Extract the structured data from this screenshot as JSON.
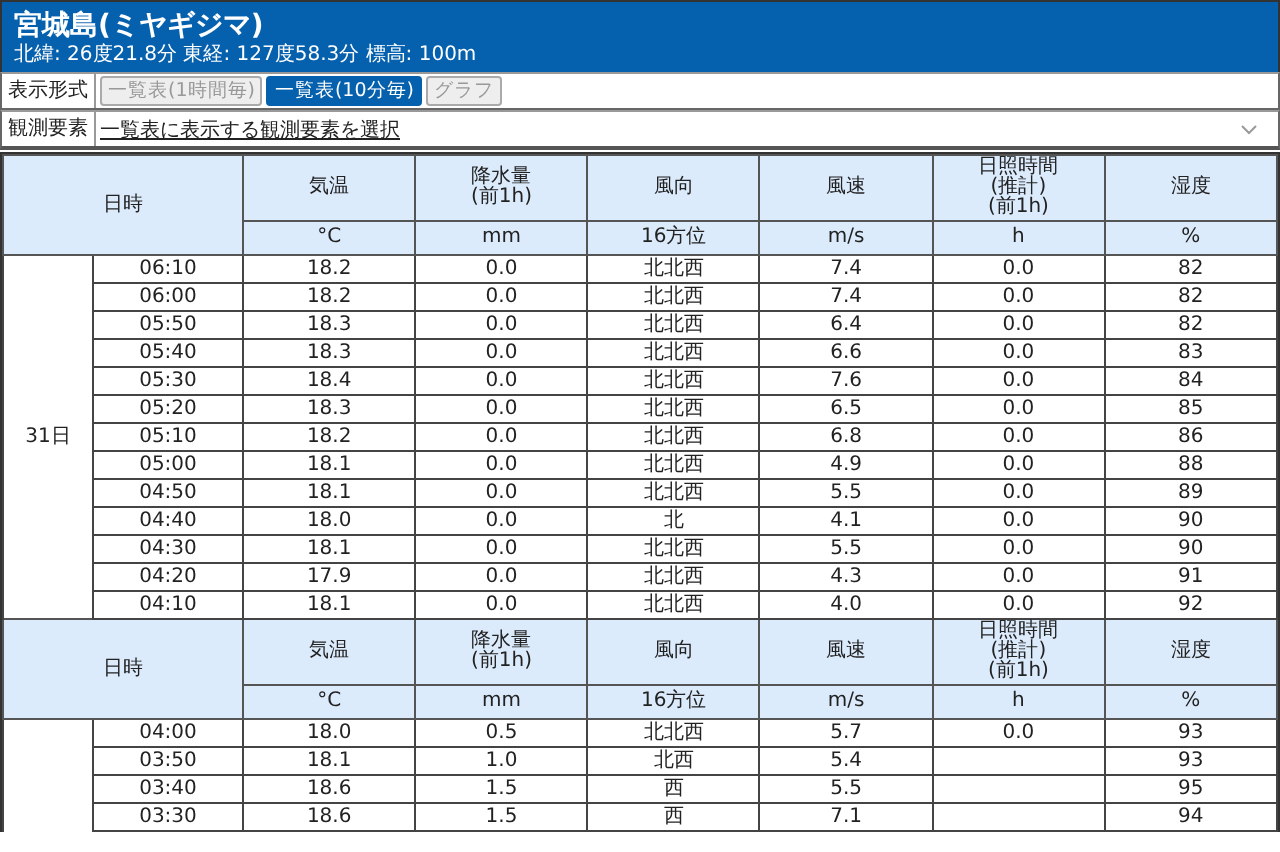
{
  "station": {
    "title": "宮城島(ミヤギジマ)",
    "coords": "北緯: 26度21.8分 東経: 127度58.3分 標高: 100m"
  },
  "display_format": {
    "label": "表示形式",
    "buttons": [
      {
        "label": "一覧表(1時間毎)",
        "selected": false
      },
      {
        "label": "一覧表(10分毎)",
        "selected": true
      },
      {
        "label": "グラフ",
        "selected": false
      }
    ]
  },
  "elements": {
    "label": "観測要素",
    "dropdown": "一覧表に表示する観測要素を選択"
  },
  "blocks": [
    {
      "columns": [
        {
          "label": "日時"
        },
        {
          "label": "気温",
          "unit": "°C"
        },
        {
          "label": "降水量\n(前1h)",
          "unit": "mm"
        },
        {
          "label": "風向",
          "unit": "16方位"
        },
        {
          "label": "風速",
          "unit": "m/s"
        },
        {
          "label": "日照時間\n(推計)\n(前1h)",
          "unit": "h"
        },
        {
          "label": "湿度",
          "unit": "%"
        }
      ],
      "date": "31日",
      "rows": [
        {
          "time": "06:10",
          "temp": "18.2",
          "precip": "0.0",
          "wind_dir": "北北西",
          "wind_speed": "7.4",
          "sunshine": "0.0",
          "humidity": "82"
        },
        {
          "time": "06:00",
          "temp": "18.2",
          "precip": "0.0",
          "wind_dir": "北北西",
          "wind_speed": "7.4",
          "sunshine": "0.0",
          "humidity": "82"
        },
        {
          "time": "05:50",
          "temp": "18.3",
          "precip": "0.0",
          "wind_dir": "北北西",
          "wind_speed": "6.4",
          "sunshine": "0.0",
          "humidity": "82"
        },
        {
          "time": "05:40",
          "temp": "18.3",
          "precip": "0.0",
          "wind_dir": "北北西",
          "wind_speed": "6.6",
          "sunshine": "0.0",
          "humidity": "83"
        },
        {
          "time": "05:30",
          "temp": "18.4",
          "precip": "0.0",
          "wind_dir": "北北西",
          "wind_speed": "7.6",
          "sunshine": "0.0",
          "humidity": "84"
        },
        {
          "time": "05:20",
          "temp": "18.3",
          "precip": "0.0",
          "wind_dir": "北北西",
          "wind_speed": "6.5",
          "sunshine": "0.0",
          "humidity": "85"
        },
        {
          "time": "05:10",
          "temp": "18.2",
          "precip": "0.0",
          "wind_dir": "北北西",
          "wind_speed": "6.8",
          "sunshine": "0.0",
          "humidity": "86"
        },
        {
          "time": "05:00",
          "temp": "18.1",
          "precip": "0.0",
          "wind_dir": "北北西",
          "wind_speed": "4.9",
          "sunshine": "0.0",
          "humidity": "88"
        },
        {
          "time": "04:50",
          "temp": "18.1",
          "precip": "0.0",
          "wind_dir": "北北西",
          "wind_speed": "5.5",
          "sunshine": "0.0",
          "humidity": "89"
        },
        {
          "time": "04:40",
          "temp": "18.0",
          "precip": "0.0",
          "wind_dir": "北",
          "wind_speed": "4.1",
          "sunshine": "0.0",
          "humidity": "90"
        },
        {
          "time": "04:30",
          "temp": "18.1",
          "precip": "0.0",
          "wind_dir": "北北西",
          "wind_speed": "5.5",
          "sunshine": "0.0",
          "humidity": "90"
        },
        {
          "time": "04:20",
          "temp": "17.9",
          "precip": "0.0",
          "wind_dir": "北北西",
          "wind_speed": "4.3",
          "sunshine": "0.0",
          "humidity": "91"
        },
        {
          "time": "04:10",
          "temp": "18.1",
          "precip": "0.0",
          "wind_dir": "北北西",
          "wind_speed": "4.0",
          "sunshine": "0.0",
          "humidity": "92"
        }
      ]
    },
    {
      "columns": [
        {
          "label": "日時"
        },
        {
          "label": "気温",
          "unit": "°C"
        },
        {
          "label": "降水量\n(前1h)",
          "unit": "mm"
        },
        {
          "label": "風向",
          "unit": "16方位"
        },
        {
          "label": "風速",
          "unit": "m/s"
        },
        {
          "label": "日照時間\n(推計)\n(前1h)",
          "unit": "h"
        },
        {
          "label": "湿度",
          "unit": "%"
        }
      ],
      "rows": [
        {
          "time": "04:00",
          "temp": "18.0",
          "precip": "0.5",
          "wind_dir": "北北西",
          "wind_speed": "5.7",
          "sunshine": "0.0",
          "humidity": "93"
        },
        {
          "time": "03:50",
          "temp": "18.1",
          "precip": "1.0",
          "wind_dir": "北西",
          "wind_speed": "5.4",
          "humidity": "93"
        },
        {
          "time": "03:40",
          "temp": "18.6",
          "precip": "1.5",
          "wind_dir": "西",
          "wind_speed": "5.5",
          "humidity": "95"
        },
        {
          "time": "03:30",
          "temp": "18.6",
          "precip": "1.5",
          "wind_dir": "西",
          "wind_speed": "7.1",
          "humidity": "94"
        }
      ]
    }
  ]
}
